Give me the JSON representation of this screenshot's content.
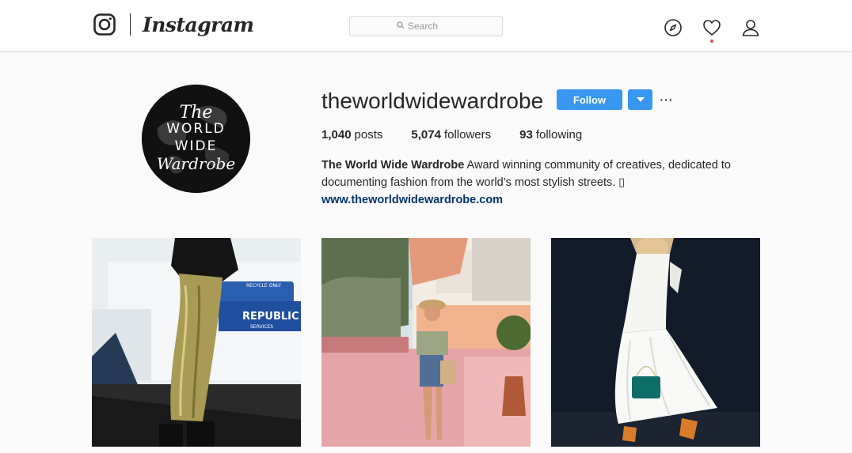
{
  "nav": {
    "brand": "Instagram",
    "search_placeholder": "Search",
    "icons": [
      "instagram-glyph-icon",
      "compass-icon",
      "heart-icon",
      "user-icon"
    ]
  },
  "profile": {
    "username": "theworldwidewardrobe",
    "follow_label": "Follow",
    "more_label": "···",
    "avatar_text": [
      "The",
      "WORLD",
      "WIDE",
      "Wardrobe"
    ],
    "stats": [
      {
        "count": "1,040",
        "label": "posts"
      },
      {
        "count": "5,074",
        "label": "followers"
      },
      {
        "count": "93",
        "label": "following"
      }
    ],
    "bio_name": "The World Wide Wardrobe",
    "bio_text": " Award winning community of creatives, dedicated to documenting fashion from the world’s most stylish streets. ▯",
    "website": "www.theworldwidewardrobe.com"
  },
  "colors": {
    "accent": "#3897f0",
    "link": "#003569",
    "notification": "#ed4956"
  },
  "posts": [
    {
      "photo_text": [
        "REPUBLIC",
        "SERVICES",
        "RECYCLE ONLY"
      ]
    },
    {
      "photo_text": []
    },
    {
      "photo_text": []
    }
  ]
}
